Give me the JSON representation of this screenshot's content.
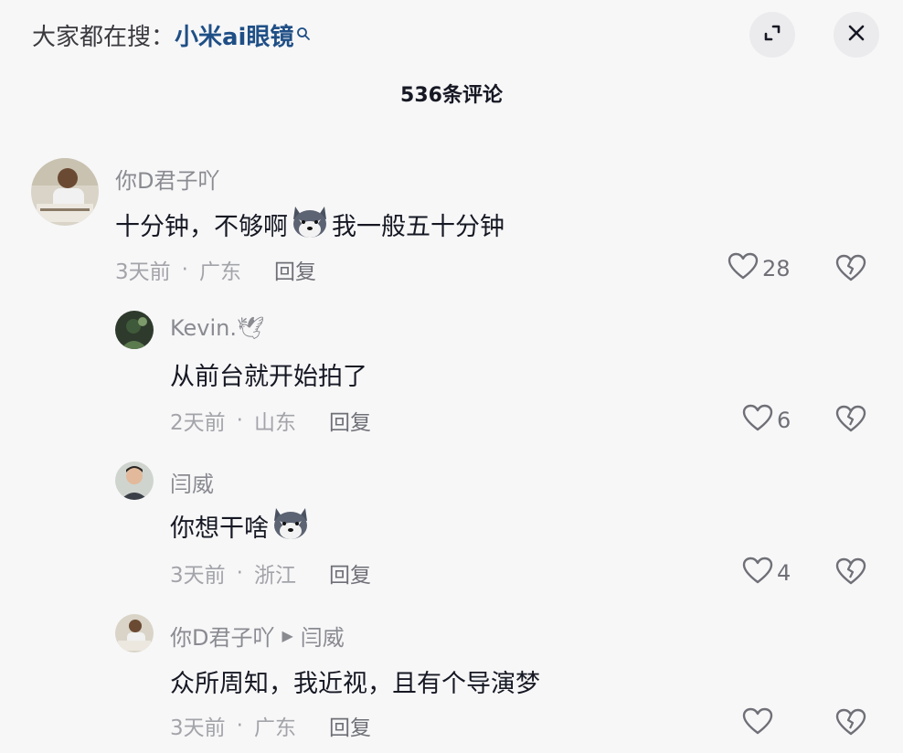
{
  "header": {
    "search_prefix": "大家都在搜：",
    "search_term": "小米ai眼镜",
    "expand_icon": "expand-icon",
    "close_icon": "close-icon"
  },
  "comment_count": "536条评论",
  "comments": [
    {
      "username": "你D君子吖",
      "text_before": "十分钟，不够啊",
      "emoji": "husky-emoji",
      "text_after": "我一般五十分钟",
      "time": "3天前",
      "location": "广东",
      "reply_label": "回复",
      "likes": "28"
    },
    {
      "username": "Kevin.🕊",
      "text": "从前台就开始拍了",
      "time": "2天前",
      "location": "山东",
      "reply_label": "回复",
      "likes": "6"
    },
    {
      "username": "闫威",
      "text_before": "你想干啥",
      "emoji": "husky-emoji",
      "time": "3天前",
      "location": "浙江",
      "reply_label": "回复",
      "likes": "4"
    },
    {
      "username": "你D君子吖",
      "reply_to": "闫威",
      "text": "众所周知，我近视，且有个导演梦",
      "time": "3天前",
      "location": "广东",
      "reply_label": "回复",
      "likes": ""
    }
  ],
  "colors": {
    "background": "#f7f7f8",
    "search_term": "#1f4f86",
    "username": "#8a8b91",
    "meta": "#a3a4a9"
  }
}
